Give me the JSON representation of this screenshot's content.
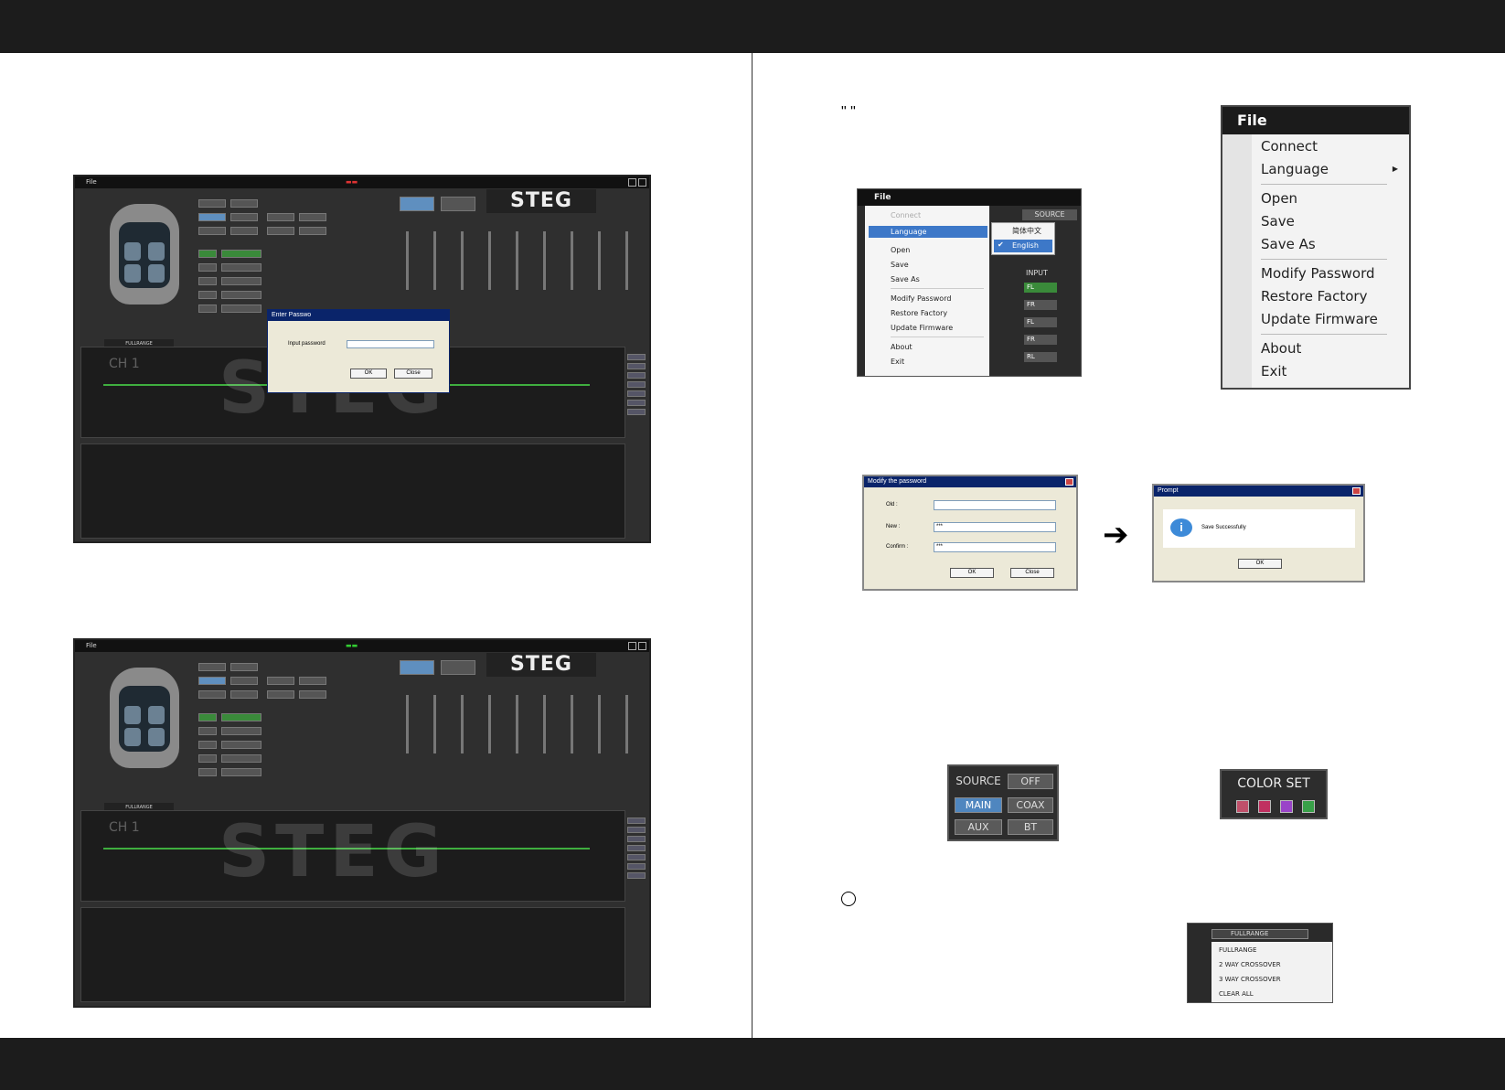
{
  "screenshot1": {
    "menu": "File",
    "brand": "STEG",
    "channel": "CH 1",
    "car_mode": "FULLRANGE",
    "dialog_title": "Enter Passwo",
    "dialog_label": "Input password",
    "ok": "OK",
    "close": "Close"
  },
  "screenshot2": {
    "menu": "File",
    "brand": "STEG",
    "channel": "CH 1",
    "car_mode": "FULLRANGE"
  },
  "quote_marks": "\"      \"",
  "file_menu": {
    "title": "File",
    "items": [
      "Connect",
      "Language",
      "Open",
      "Save",
      "Save As",
      "Modify Password",
      "Restore Factory",
      "Update Firmware",
      "About",
      "Exit"
    ]
  },
  "file_menu_small": {
    "title": "File",
    "items": [
      "Connect",
      "Language",
      "Open",
      "Save",
      "Save As",
      "Modify Password",
      "Restore Factory",
      "Update Firmware",
      "About",
      "Exit"
    ],
    "language_options": [
      "简体中文",
      "English"
    ],
    "right_labels": [
      "SOURCE",
      "INPUT",
      "FL",
      "FR",
      "FL",
      "FR",
      "RL"
    ]
  },
  "modify_dialog": {
    "title": "Modify the password",
    "labels": [
      "Old :",
      "New :",
      "Confirm :"
    ],
    "new_value": "***",
    "confirm_value": "***",
    "ok": "OK",
    "close": "Close"
  },
  "prompt_dialog": {
    "title": "Prompt",
    "message": "Save Successfully",
    "ok": "OK"
  },
  "source_widget": {
    "title": "SOURCE",
    "buttons": [
      "OFF",
      "MAIN",
      "COAX",
      "AUX",
      "BT"
    ],
    "selected": "MAIN"
  },
  "color_widget": {
    "title": "COLOR SET",
    "swatches": [
      "#c0506a",
      "#c03060",
      "#9a44c8",
      "#38a048"
    ]
  },
  "fullrange_widget": {
    "current": "FULLRANGE",
    "options": [
      "FULLRANGE",
      "2 WAY CROSSOVER",
      "3 WAY CROSSOVER",
      "CLEAR ALL"
    ]
  }
}
